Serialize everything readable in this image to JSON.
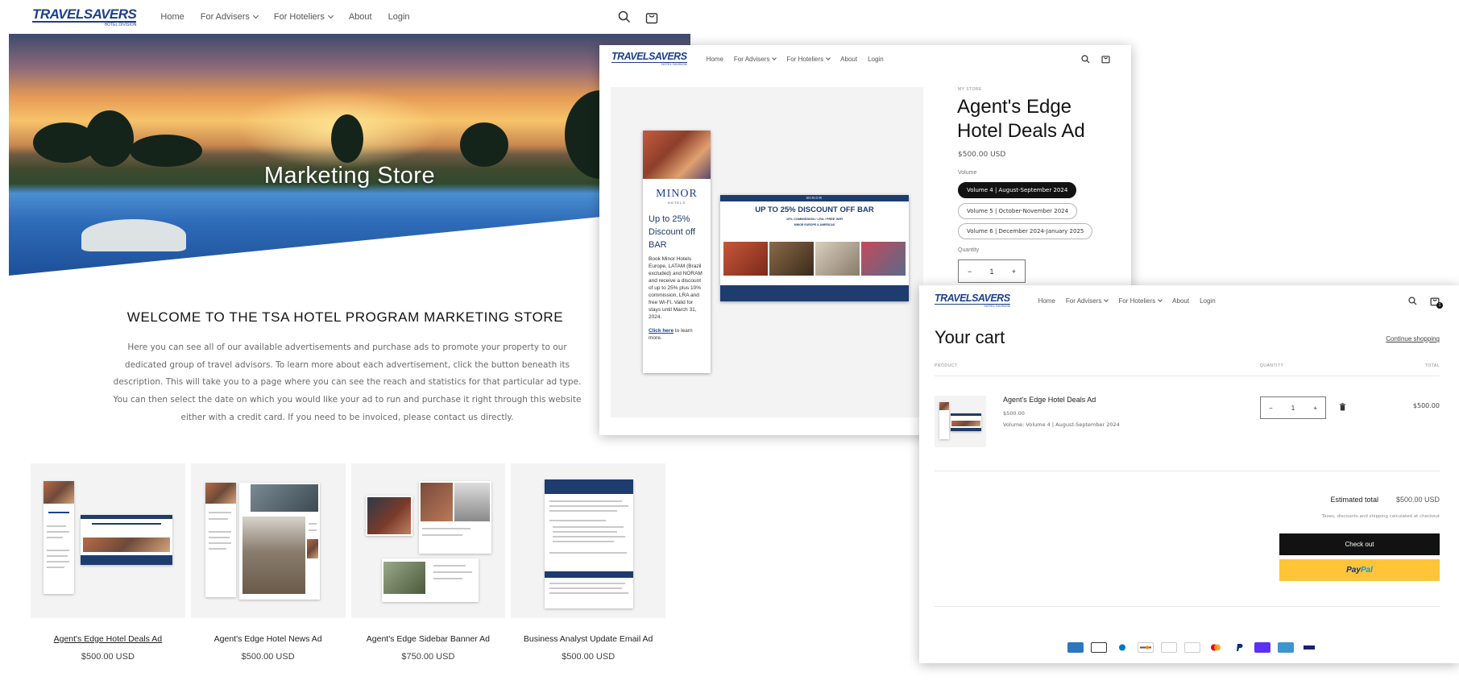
{
  "colors": {
    "brand_blue": "#1d3f8f",
    "ad_navy": "#1e3c6d",
    "checkout_black": "#121212",
    "paypal_yellow": "#ffc439"
  },
  "store": {
    "logo_main": "TRAVELSAVERS",
    "logo_sub": "HOTEL DIVISION",
    "nav": {
      "home": "Home",
      "advisers": "For Advisers",
      "hoteliers": "For Hoteliers",
      "about": "About",
      "login": "Login"
    },
    "icons": [
      "search-icon",
      "cart-icon"
    ],
    "hero_title": "Marketing Store",
    "welcome_title": "WELCOME TO THE TSA HOTEL PROGRAM MARKETING STORE",
    "welcome_body": "Here you can see all of our available advertisements and purchase ads to promote your property to our dedicated group of travel advisors. To learn more about each advertisement, click the button beneath its description. This will take you to a page where you can see the reach and statistics for that particular ad type. You can then select the date on which you would like your ad to run and purchase it right through this website either with a credit card. If you need to be invoiced, please contact us directly.",
    "products": [
      {
        "title": "Agent's Edge Hotel Deals Ad",
        "price": "$500.00 USD"
      },
      {
        "title": "Agent's Edge Hotel News Ad",
        "price": "$500.00 USD"
      },
      {
        "title": "Agent's Edge Sidebar Banner Ad",
        "price": "$750.00 USD"
      },
      {
        "title": "Business Analyst Update Email Ad",
        "price": "$500.00 USD"
      }
    ]
  },
  "product": {
    "vendor": "MY STORE",
    "title": "Agent's Edge Hotel Deals Ad",
    "price": "$500.00 USD",
    "volume_label": "Volume",
    "volumes": [
      "Volume 4 | August-September 2024",
      "Volume 5 | October-November 2024",
      "Volume 6 | December 2024-January 2025"
    ],
    "selected_volume_index": 0,
    "quantity_label": "Quantity",
    "quantity": "1",
    "ad": {
      "brand": "MINOR",
      "brand_sub": "HOTELS",
      "flyer_headline": "Up to 25% Discount off BAR",
      "flyer_body": "Book Minor Hotels Europe, LATAM (Brazil excluded) and NORAM and receive a discount of up to 25% plus 10% commission, LRA and free Wi-Fi. Valid for stays until March 31, 2024.",
      "flyer_link": "Click here",
      "flyer_link_rest": " to learn more.",
      "banner_headline": "UP TO 25% DISCOUNT OFF BAR",
      "banner_line1": "10% COMMISSION / LRA / FREE WIFI",
      "banner_line2": "MINOR EUROPE & AMERICAS"
    }
  },
  "cart": {
    "title": "Your cart",
    "continue": "Continue shopping",
    "col_product": "PRODUCT",
    "col_quantity": "QUANTITY",
    "col_total": "TOTAL",
    "cart_count": "1",
    "item": {
      "name": "Agent's Edge Hotel Deals Ad",
      "price": "$500.00",
      "variant": "Volume: Volume 4 | August-September 2024",
      "quantity": "1",
      "total": "$500.00"
    },
    "estimated_label": "Estimated total",
    "estimated_value": "$500.00 USD",
    "taxes_note": "Taxes, discounts and shipping calculated at checkout",
    "checkout": "Check out",
    "paypal_1": "Pay",
    "paypal_2": "Pal",
    "payment_icons": [
      "amex",
      "apple-pay",
      "diners",
      "discover",
      "google-pay",
      "g-pay",
      "mastercard",
      "paypal",
      "shop-pay",
      "venmo",
      "visa"
    ]
  }
}
